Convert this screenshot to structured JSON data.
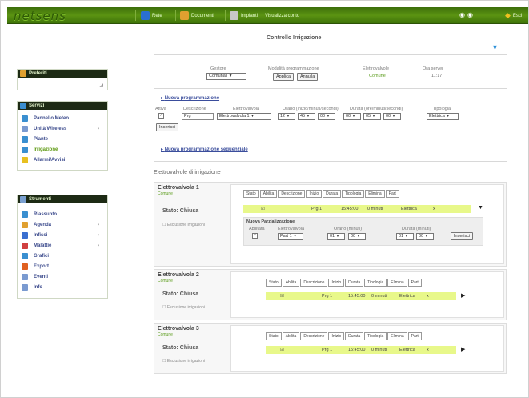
{
  "app": {
    "logo": "netsens"
  },
  "topnav": [
    {
      "label": "Rete",
      "color": "#2a6fd0"
    },
    {
      "label": "Documenti",
      "color": "#e0a030"
    },
    {
      "label": "Impianti",
      "color": "#c8c8c8"
    },
    {
      "label": "Visualizza conto",
      "color": "#c8c8c8"
    }
  ],
  "topright": {
    "exit_label": "Esci"
  },
  "sidebar": {
    "box1": {
      "title": "Preferiti"
    },
    "box2": {
      "title": "Servizi",
      "items": [
        {
          "label": "Pannello Meteo",
          "icon": "weather-icon",
          "icon_color": "#3a8fd0"
        },
        {
          "label": "Unità Wireless",
          "icon": "wireless-icon",
          "icon_color": "#7a9ad0",
          "has_arrow": true
        },
        {
          "label": "Piante",
          "icon": "plant-icon",
          "icon_color": "#3a8fd0"
        },
        {
          "label": "Irrigazione",
          "icon": "drop-icon",
          "icon_color": "#3a8fd0",
          "active": true
        },
        {
          "label": "Allarmi/Avvisi",
          "icon": "warning-icon",
          "icon_color": "#e8c020"
        }
      ]
    },
    "box3": {
      "title": "Strumenti",
      "items": [
        {
          "label": "Riassunto",
          "icon": "summary-icon",
          "icon_color": "#3a8fd0"
        },
        {
          "label": "Agenda",
          "icon": "agenda-icon",
          "icon_color": "#e0a030",
          "has_arrow": true
        },
        {
          "label": "Infissi",
          "icon": "pin-icon",
          "icon_color": "#3a6fd0",
          "has_arrow": true
        },
        {
          "label": "Malattie",
          "icon": "bug-icon",
          "icon_color": "#d04040",
          "has_arrow": true
        },
        {
          "label": "Grafici",
          "icon": "chart-icon",
          "icon_color": "#3a8fd0"
        },
        {
          "label": "Export",
          "icon": "export-icon",
          "icon_color": "#e06020"
        },
        {
          "label": "Eventi",
          "icon": "events-icon",
          "icon_color": "#7a9ad0"
        },
        {
          "label": "Info",
          "icon": "info-icon",
          "icon_color": "#7a9ad0"
        }
      ]
    }
  },
  "main": {
    "title": "Controllo Irrigazione",
    "filters": {
      "gestore_label": "Gestore",
      "gestore_value": "Comunali",
      "mode_label": "Modalità programmazione",
      "apply_label": "Applica",
      "cancel_label": "Annulla",
      "valve_label": "Elettrovalvole",
      "valve_value": "Comune",
      "time_label": "Ora server",
      "time_value": "11:17"
    },
    "new_program": {
      "link": "Nuova programmazione",
      "active_label": "Attiva",
      "desc_label": "Descrizione",
      "desc_value": "Prg",
      "valve_label": "Elettrovalvola",
      "valve_value": "Elettrovalvola 1",
      "start_label": "Orario (inizio/minuti/secondi)",
      "start": [
        "12",
        "45",
        "00"
      ],
      "dur_label": "Durata (ore/minuti/secondi)",
      "dur": [
        "00",
        "05",
        "00"
      ],
      "type_label": "Tipologia",
      "type_value": "Elettrica",
      "insert_label": "Inserisci"
    },
    "seq_link": "Nuova programmazione sequenziale",
    "valves_title": "Elettrovalvole di irrigazione",
    "table_headers": [
      "Stato",
      "Abilita",
      "Descrizione",
      "Inizio",
      "Durata",
      "Tipologia",
      "Elimina",
      "Part"
    ],
    "valves": [
      {
        "name": "Elettrovalvola 1",
        "sub": "Comune",
        "status": "Stato: Chiusa",
        "check_label": "Esclusione irrigazioni",
        "row": {
          "desc": "Prg 1",
          "start": "15:45:00",
          "dur": "0 minuti",
          "type": "Elettrica",
          "del": "x"
        },
        "new_box": {
          "title": "Nuova Parzializzazione",
          "active_label": "Abilitata",
          "valve_label": "Elettrovalvola",
          "valve_value": "Part 1",
          "start_label": "Orario (minuti)",
          "start": [
            "01",
            "00"
          ],
          "dur_label": "Durata (minuti)",
          "dur": [
            "01",
            "00"
          ],
          "insert_label": "Inserisci"
        }
      },
      {
        "name": "Elettrovalvola 2",
        "sub": "Comune",
        "status": "Stato: Chiusa",
        "check_label": "Esclusione irrigazioni",
        "row": {
          "desc": "Prg 1",
          "start": "15:45:00",
          "dur": "0 minuti",
          "type": "Elettrica",
          "del": "x"
        }
      },
      {
        "name": "Elettrovalvola 3",
        "sub": "Comune",
        "status": "Stato: Chiusa",
        "check_label": "Esclusione irrigazioni",
        "row": {
          "desc": "Prg 1",
          "start": "15:45:00",
          "dur": "0 minuti",
          "type": "Elettrica",
          "del": "x"
        }
      }
    ]
  }
}
